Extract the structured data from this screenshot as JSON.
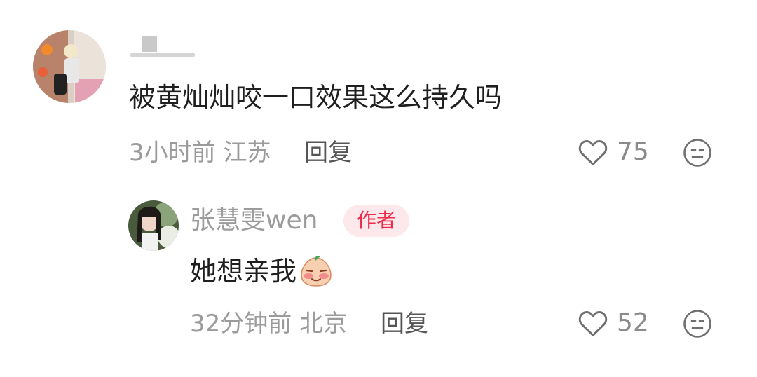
{
  "comment": {
    "text": "被黄灿灿咬一口效果这么持久吗",
    "time_location": "3小时前 江苏",
    "reply_label": "回复",
    "likes": "75"
  },
  "reply": {
    "username": "张慧雯wen",
    "badge": "作者",
    "text": "她想亲我",
    "time_location": "32分钟前 北京",
    "reply_label": "回复",
    "likes": "52"
  },
  "icons": {
    "like": "heart-outline-icon",
    "dislike": "neutral-face-icon"
  },
  "colors": {
    "badge_bg": "#fde8ec",
    "badge_text": "#ee2c4a",
    "muted_text": "#9b9b9b"
  }
}
